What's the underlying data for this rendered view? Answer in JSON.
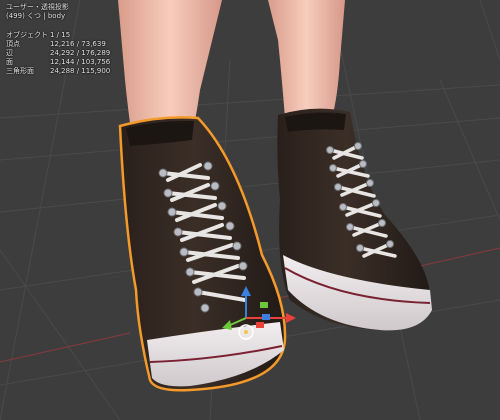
{
  "viewport": {
    "view_name": "ユーザー・透視投影",
    "object_info": "(499) くつ | body",
    "background": "#3d3d3d",
    "selection_outline_color": "#f39a2a"
  },
  "stats": [
    {
      "label": "オブジェクト",
      "value": "1 / 15"
    },
    {
      "label": "頂点",
      "value": "12,216 / 73,639"
    },
    {
      "label": "辺",
      "value": "24,292 / 176,289"
    },
    {
      "label": "面",
      "value": "12,144 / 103,756"
    },
    {
      "label": "三角形面",
      "value": "24,288 / 115,900"
    }
  ],
  "gizmo": {
    "icons": [
      "move-arrow-x-icon",
      "move-arrow-y-icon",
      "move-arrow-z-icon",
      "pivot-circle-icon"
    ],
    "colors": {
      "x": "#e8423a",
      "y": "#6ec93a",
      "z": "#3b7fe0"
    }
  }
}
